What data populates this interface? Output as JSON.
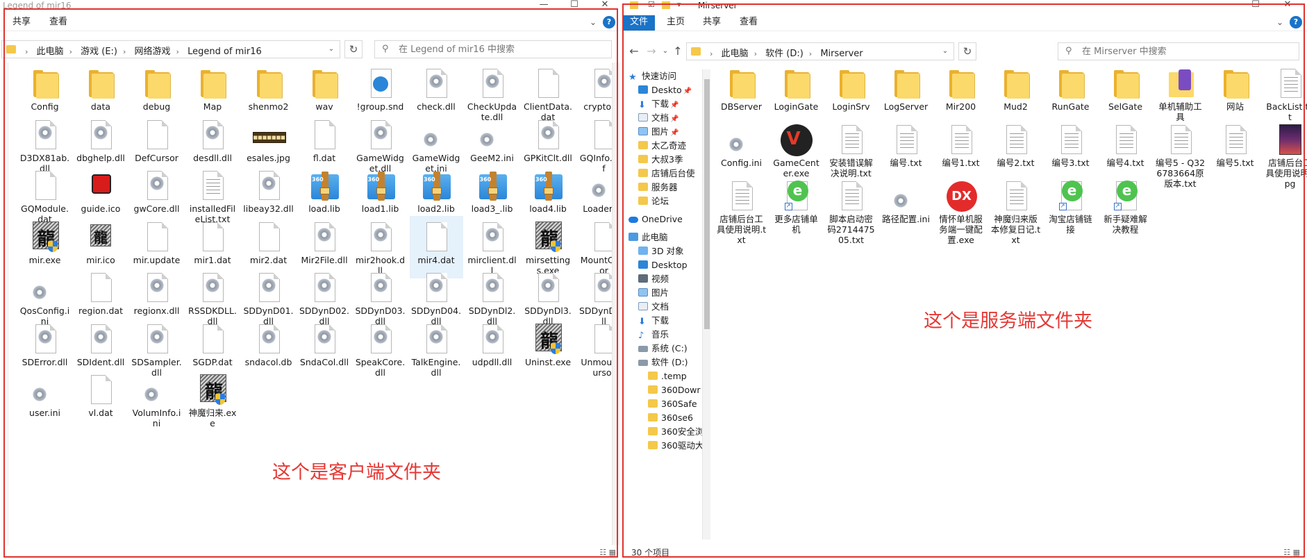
{
  "left": {
    "window_title": "Legend of mir16",
    "ribbon": {
      "tabs": [
        "共享",
        "查看"
      ]
    },
    "breadcrumb": [
      "此电脑",
      "游戏 (E:)",
      "网络游戏",
      "Legend of mir16"
    ],
    "search_placeholder": "在 Legend of mir16 中搜索",
    "annotation": "这个是客户端文件夹",
    "items": [
      {
        "name": "Config",
        "icon": "folder"
      },
      {
        "name": "data",
        "icon": "folder"
      },
      {
        "name": "debug",
        "icon": "folder"
      },
      {
        "name": "Map",
        "icon": "folder"
      },
      {
        "name": "shenmo2",
        "icon": "folder"
      },
      {
        "name": "wav",
        "icon": "folder"
      },
      {
        "name": "!group.snd",
        "icon": "audio"
      },
      {
        "name": "check.dll",
        "icon": "dll"
      },
      {
        "name": "CheckUpdate.dll",
        "icon": "dll"
      },
      {
        "name": "ClientData.dat",
        "icon": "file"
      },
      {
        "name": "crypto.dll",
        "icon": "dll"
      },
      {
        "name": "D3DX81ab.dll",
        "icon": "dll"
      },
      {
        "name": "dbghelp.dll",
        "icon": "dll"
      },
      {
        "name": "DefCursor",
        "icon": "file"
      },
      {
        "name": "desdll.dll",
        "icon": "dll"
      },
      {
        "name": "esales.jpg",
        "icon": "esales"
      },
      {
        "name": "fl.dat",
        "icon": "file"
      },
      {
        "name": "GameWidget.dll",
        "icon": "dll"
      },
      {
        "name": "GameWidget.ini",
        "icon": "ini"
      },
      {
        "name": "GeeM2.ini",
        "icon": "ini"
      },
      {
        "name": "GPKitClt.dll",
        "icon": "dll"
      },
      {
        "name": "GQInfo.conf",
        "icon": "file"
      },
      {
        "name": "GQModule.dat",
        "icon": "file"
      },
      {
        "name": "guide.ico",
        "icon": "redico"
      },
      {
        "name": "gwCore.dll",
        "icon": "dll"
      },
      {
        "name": "installedFileList.txt",
        "icon": "txt"
      },
      {
        "name": "libeay32.dll",
        "icon": "dll"
      },
      {
        "name": "load.lib",
        "icon": "zip"
      },
      {
        "name": "load1.lib",
        "icon": "zip"
      },
      {
        "name": "load2.lib",
        "icon": "zip"
      },
      {
        "name": "load3_.lib",
        "icon": "zip"
      },
      {
        "name": "load4.lib",
        "icon": "zip"
      },
      {
        "name": "Loader.ini",
        "icon": "ini"
      },
      {
        "name": "mir.exe",
        "icon": "dragon"
      },
      {
        "name": "mir.ico",
        "icon": "dragon-small"
      },
      {
        "name": "mir.update",
        "icon": "file"
      },
      {
        "name": "mir1.dat",
        "icon": "file"
      },
      {
        "name": "mir2.dat",
        "icon": "file"
      },
      {
        "name": "Mir2File.dll",
        "icon": "dll"
      },
      {
        "name": "mir2hook.dll",
        "icon": "dll"
      },
      {
        "name": "mir4.dat",
        "icon": "file",
        "selected": true
      },
      {
        "name": "mirclient.dll",
        "icon": "dll"
      },
      {
        "name": "mirsettings.exe",
        "icon": "dragon"
      },
      {
        "name": "MountCursor",
        "icon": "file"
      },
      {
        "name": "QosConfig.ini",
        "icon": "ini"
      },
      {
        "name": "region.dat",
        "icon": "file"
      },
      {
        "name": "regionx.dll",
        "icon": "dll"
      },
      {
        "name": "RSSDKDLL.dll",
        "icon": "dll"
      },
      {
        "name": "SDDynD01.dll",
        "icon": "dll"
      },
      {
        "name": "SDDynD02.dll",
        "icon": "dll"
      },
      {
        "name": "SDDynD03.dll",
        "icon": "dll"
      },
      {
        "name": "SDDynD04.dll",
        "icon": "dll"
      },
      {
        "name": "SDDynDl2.dll",
        "icon": "dll"
      },
      {
        "name": "SDDynDl3.dll",
        "icon": "dll"
      },
      {
        "name": "SDDynDll.dll",
        "icon": "dll"
      },
      {
        "name": "SDError.dll",
        "icon": "dll"
      },
      {
        "name": "SDIdent.dll",
        "icon": "dll"
      },
      {
        "name": "SDSampler.dll",
        "icon": "dll"
      },
      {
        "name": "SGDP.dat",
        "icon": "file"
      },
      {
        "name": "sndacol.db",
        "icon": "dll"
      },
      {
        "name": "SndaCol.dll",
        "icon": "dll"
      },
      {
        "name": "SpeakCore.dll",
        "icon": "dll"
      },
      {
        "name": "TalkEngine.dll",
        "icon": "dll"
      },
      {
        "name": "udpdll.dll",
        "icon": "dll"
      },
      {
        "name": "Uninst.exe",
        "icon": "dragon"
      },
      {
        "name": "UnmountCursor",
        "icon": "file"
      },
      {
        "name": "user.ini",
        "icon": "ini"
      },
      {
        "name": "vl.dat",
        "icon": "file"
      },
      {
        "name": "VolumInfo.ini",
        "icon": "ini"
      },
      {
        "name": "神魔归来.exe",
        "icon": "dragon"
      }
    ]
  },
  "right": {
    "window_title": "Mirserver",
    "ribbon": {
      "tabs": [
        "文件",
        "主页",
        "共享",
        "查看"
      ],
      "active_tab": "文件"
    },
    "breadcrumb": [
      "此电脑",
      "软件 (D:)",
      "Mirserver"
    ],
    "search_placeholder": "在 Mirserver 中搜索",
    "annotation": "这个是服务端文件夹",
    "status_text": "30 个项目",
    "sidebar": [
      {
        "label": "快速访问",
        "icon": "star-icon",
        "indent": 0
      },
      {
        "label": "Deskto",
        "icon": "desktop-icon",
        "indent": 1,
        "pinned": true
      },
      {
        "label": "下载",
        "icon": "download-icon",
        "indent": 1,
        "pinned": true
      },
      {
        "label": "文档",
        "icon": "document-icon",
        "indent": 1,
        "pinned": true
      },
      {
        "label": "图片",
        "icon": "picture-icon",
        "indent": 1,
        "pinned": true
      },
      {
        "label": "太乙奇迹",
        "icon": "folder-icon",
        "indent": 1
      },
      {
        "label": "大叔3季",
        "icon": "folder-icon",
        "indent": 1
      },
      {
        "label": "店铺后台使",
        "icon": "folder-icon",
        "indent": 1
      },
      {
        "label": "服务器",
        "icon": "folder-icon",
        "indent": 1
      },
      {
        "label": "论坛",
        "icon": "folder-icon",
        "indent": 1
      },
      {
        "label": "OneDrive",
        "icon": "onedrive-icon",
        "indent": 0
      },
      {
        "label": "此电脑",
        "icon": "computer-icon",
        "indent": 0
      },
      {
        "label": "3D 对象",
        "icon": "3d-objects-icon",
        "indent": 1
      },
      {
        "label": "Desktop",
        "icon": "desktop-icon",
        "indent": 1
      },
      {
        "label": "视频",
        "icon": "video-icon",
        "indent": 1
      },
      {
        "label": "图片",
        "icon": "picture-icon",
        "indent": 1
      },
      {
        "label": "文档",
        "icon": "document-icon",
        "indent": 1
      },
      {
        "label": "下载",
        "icon": "download-icon",
        "indent": 1
      },
      {
        "label": "音乐",
        "icon": "music-icon",
        "indent": 1
      },
      {
        "label": "系统 (C:)",
        "icon": "drive-icon",
        "indent": 1
      },
      {
        "label": "软件 (D:)",
        "icon": "drive-icon",
        "indent": 1
      },
      {
        "label": ".temp",
        "icon": "folder-icon",
        "indent": 2
      },
      {
        "label": "360Dowr",
        "icon": "folder-icon",
        "indent": 2
      },
      {
        "label": "360Safe",
        "icon": "folder-icon",
        "indent": 2
      },
      {
        "label": "360se6",
        "icon": "folder-icon",
        "indent": 2
      },
      {
        "label": "360安全浏",
        "icon": "folder-icon",
        "indent": 2
      },
      {
        "label": "360驱动大",
        "icon": "folder-icon",
        "indent": 2
      }
    ],
    "items": [
      {
        "name": "DBServer",
        "icon": "folder"
      },
      {
        "name": "LoginGate",
        "icon": "folder"
      },
      {
        "name": "LoginSrv",
        "icon": "folder"
      },
      {
        "name": "LogServer",
        "icon": "folder"
      },
      {
        "name": "Mir200",
        "icon": "folder"
      },
      {
        "name": "Mud2",
        "icon": "folder"
      },
      {
        "name": "RunGate",
        "icon": "folder"
      },
      {
        "name": "SelGate",
        "icon": "folder"
      },
      {
        "name": "单机辅助工具",
        "icon": "mixfolder"
      },
      {
        "name": "网站",
        "icon": "folder"
      },
      {
        "name": "BackList.txt",
        "icon": "txt"
      },
      {
        "name": "Config.ini",
        "icon": "ini"
      },
      {
        "name": "GameCenter.exe",
        "icon": "gamecenter"
      },
      {
        "name": "安装错误解决说明.txt",
        "icon": "txt"
      },
      {
        "name": "编号.txt",
        "icon": "txt"
      },
      {
        "name": "编号1.txt",
        "icon": "txt"
      },
      {
        "name": "编号2.txt",
        "icon": "txt"
      },
      {
        "name": "编号3.txt",
        "icon": "txt"
      },
      {
        "name": "编号4.txt",
        "icon": "txt"
      },
      {
        "name": "编号5 - Q326783664原版本.txt",
        "icon": "txt"
      },
      {
        "name": "编号5.txt",
        "icon": "txt"
      },
      {
        "name": "店铺后台工具使用说明.jpg",
        "icon": "jpgimg"
      },
      {
        "name": "店铺后台工具使用说明.txt",
        "icon": "txt"
      },
      {
        "name": "更多店铺单机",
        "icon": "ie"
      },
      {
        "name": "脚本启动密码271447505.txt",
        "icon": "txt"
      },
      {
        "name": "路径配置.ini",
        "icon": "ini"
      },
      {
        "name": "情怀单机服务端一键配置.exe",
        "icon": "dx"
      },
      {
        "name": "神魔归来版本修复日记.txt",
        "icon": "txt"
      },
      {
        "name": "淘宝店铺链接",
        "icon": "ie"
      },
      {
        "name": "新手疑难解决教程",
        "icon": "ie"
      }
    ]
  }
}
